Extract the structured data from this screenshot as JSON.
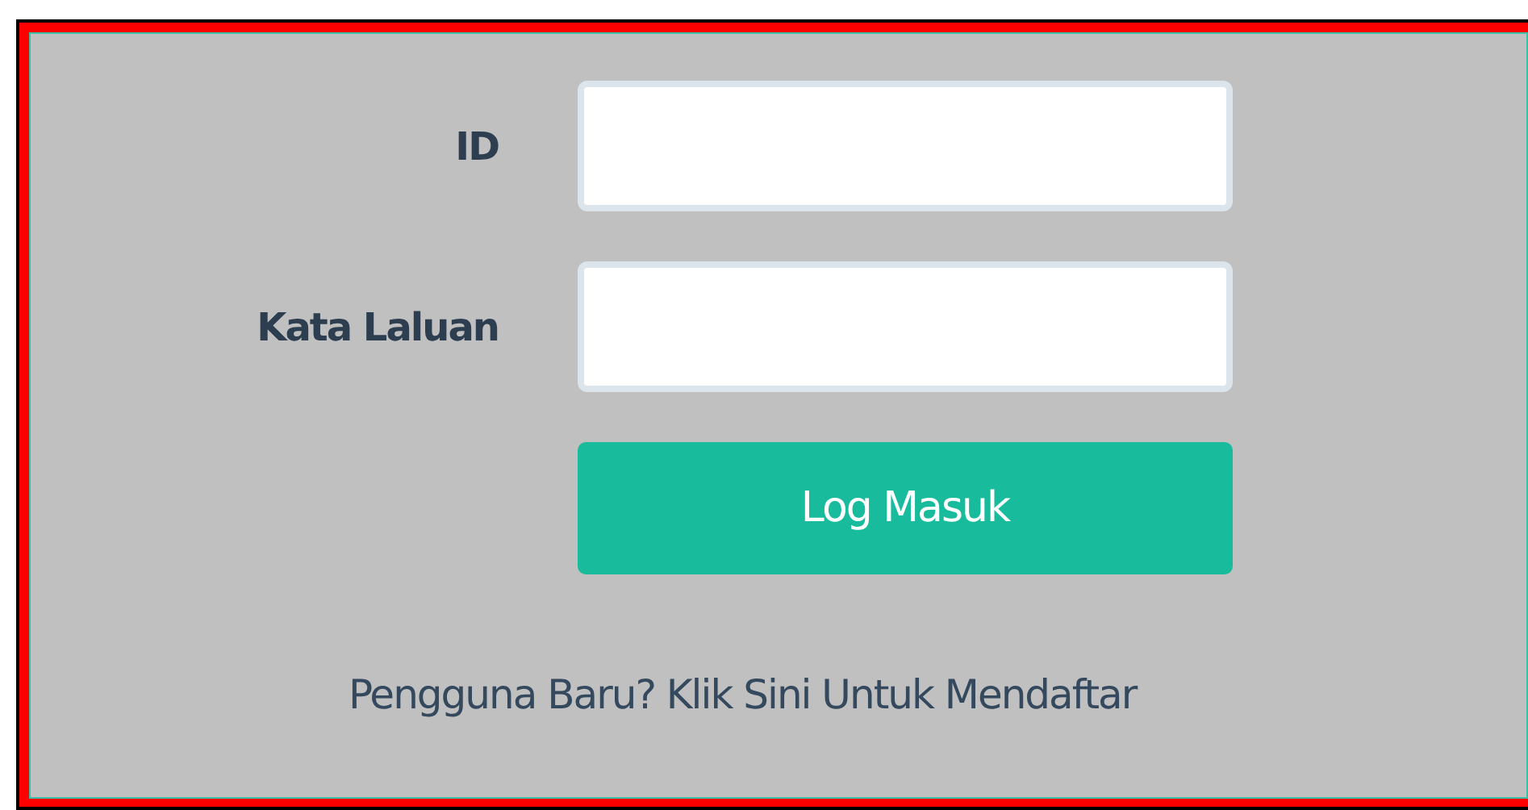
{
  "fields": [
    {
      "label": "ID"
    },
    {
      "label": "Kata Laluan"
    }
  ],
  "login_button": {
    "label": "Log Masuk"
  },
  "register_link": {
    "text": "Pengguna Baru? Klik Sini Untuk Mendaftar"
  }
}
